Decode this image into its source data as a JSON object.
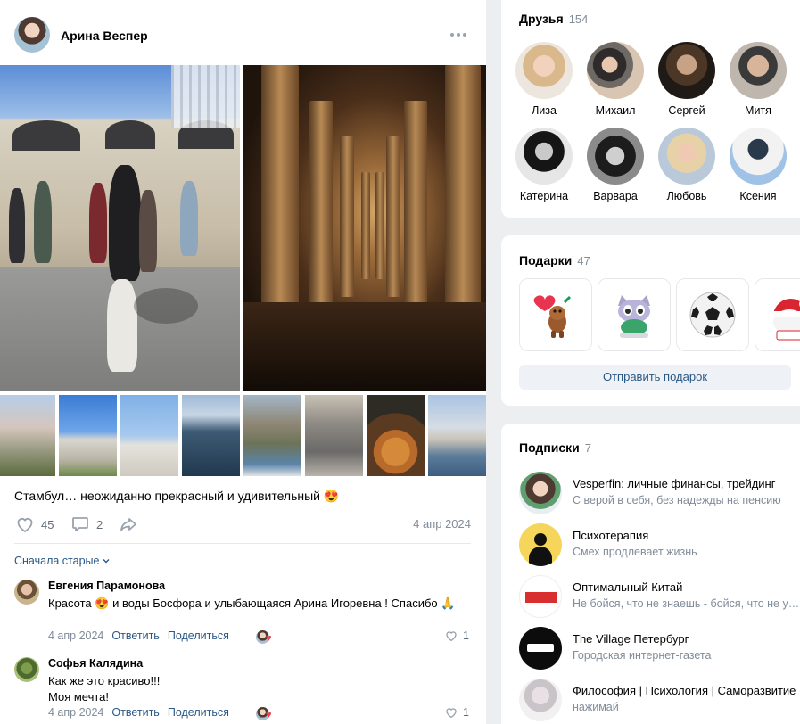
{
  "post": {
    "author": "Арина Веспер",
    "text": "Стамбул… неожиданно прекрасный и удивительный 😍",
    "likes": "45",
    "comments_count": "2",
    "date": "4 апр 2024"
  },
  "comments": {
    "sort_label": "Сначала старые",
    "items": [
      {
        "author": "Евгения Парамонова",
        "text": "Красота 😍 и воды Босфора и улыбающаяся Арина Игоревна ! Спасибо 🙏",
        "date": "4 апр 2024",
        "reply": "Ответить",
        "share": "Поделиться",
        "likes": "1"
      },
      {
        "author": "Софья Калядина",
        "text_line1": "Как же это красиво!!!",
        "text_line2": "Моя мечта!",
        "date": "4 апр 2024",
        "reply": "Ответить",
        "share": "Поделиться",
        "likes": "1"
      }
    ]
  },
  "friends": {
    "title": "Друзья",
    "count": "154",
    "items": [
      {
        "name": "Лиза"
      },
      {
        "name": "Михаил"
      },
      {
        "name": "Сергей"
      },
      {
        "name": "Митя"
      },
      {
        "name": "Катерина"
      },
      {
        "name": "Варвара"
      },
      {
        "name": "Любовь"
      },
      {
        "name": "Ксения"
      }
    ]
  },
  "gifts": {
    "title": "Подарки",
    "count": "47",
    "send_label": "Отправить подарок"
  },
  "subscriptions": {
    "title": "Подписки",
    "count": "7",
    "items": [
      {
        "name": "Vesperfin: личные финансы, трейдинг",
        "desc": "С верой в себя, без надежды на пенсию"
      },
      {
        "name": "Психотерапия",
        "desc": "Смех продлевает жизнь"
      },
      {
        "name": "Оптимальный Китай",
        "desc": "Не бойся, что не знаешь - бойся, что не учишься"
      },
      {
        "name": "The Village Петербург",
        "desc": "Городская интернет-газета"
      },
      {
        "name": "Философия | Психология | Саморазвитие",
        "desc": "нажимай"
      }
    ]
  },
  "colors": {
    "link": "#2a5885",
    "secondary_text": "#818c99",
    "background": "#edeef0",
    "heart_red": "#ff3347"
  }
}
